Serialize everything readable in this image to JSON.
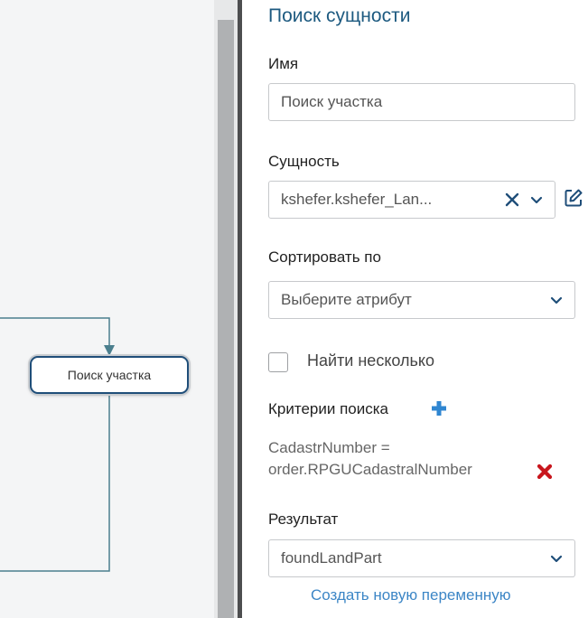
{
  "canvas": {
    "node_label": "Поиск участка"
  },
  "panel": {
    "title": "Поиск сущности",
    "name_label": "Имя",
    "name_value": "Поиск участка",
    "entity_label": "Сущность",
    "entity_value": "kshefer.kshefer_Lan...",
    "sort_label": "Сортировать по",
    "sort_placeholder": "Выберите атрибут",
    "find_multiple_label": "Найти несколько",
    "find_multiple_checked": false,
    "criteria_label": "Критерии поиска",
    "criteria_lines": [
      "CadastrNumber =",
      "order.RPGUCadastralNumber"
    ],
    "result_label": "Результат",
    "result_value": "foundLandPart",
    "create_variable_link": "Создать новую переменную"
  },
  "icons": {
    "clear": "close-icon",
    "chevron": "chevron-down-icon",
    "edit": "edit-icon",
    "add": "plus-icon",
    "remove": "remove-icon"
  },
  "colors": {
    "title": "#1d5a80",
    "link": "#3c86c6",
    "node_border": "#1f4e79",
    "connector": "#4b7f8e",
    "plus": "#2f86d1",
    "remove": "#c8161d"
  }
}
